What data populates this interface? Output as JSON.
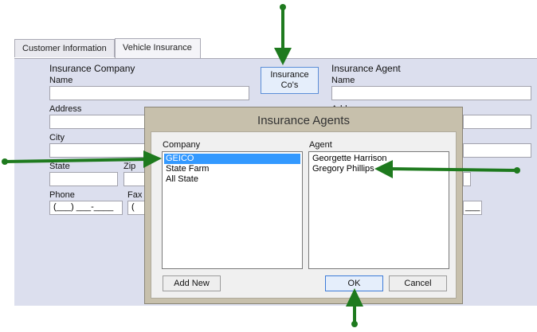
{
  "tabs": [
    "Customer Information",
    "Vehicle Insurance"
  ],
  "form": {
    "company_header": "Insurance Company",
    "name_label": "Name",
    "address_label": "Address",
    "city_label": "City",
    "state_label": "State",
    "zip_label": "Zip",
    "phone_label": "Phone",
    "fax_label": "Fax",
    "phone_mask": "(___) ___-____",
    "fax_mask": "(",
    "agent_header": "Insurance Agent",
    "agent_name_label": "Name",
    "agent_address_partial": "Add",
    "agent_mask_partial": "___",
    "ins_cos_button": [
      "Insurance",
      "Co's"
    ]
  },
  "dialog": {
    "title": "Insurance Agents",
    "company_label": "Company",
    "agent_label": "Agent",
    "companies": [
      "GEICO",
      "State Farm",
      "All State"
    ],
    "selected_company": "GEICO",
    "agents": [
      "Georgette Harrison",
      "Gregory Phillips"
    ],
    "add_new": "Add New",
    "ok": "OK",
    "cancel": "Cancel"
  },
  "colors": {
    "panel": "#dcdfee",
    "dialog_frame": "#c7c0ac",
    "selection": "#3399ff",
    "arrow": "#1e7a1e"
  }
}
